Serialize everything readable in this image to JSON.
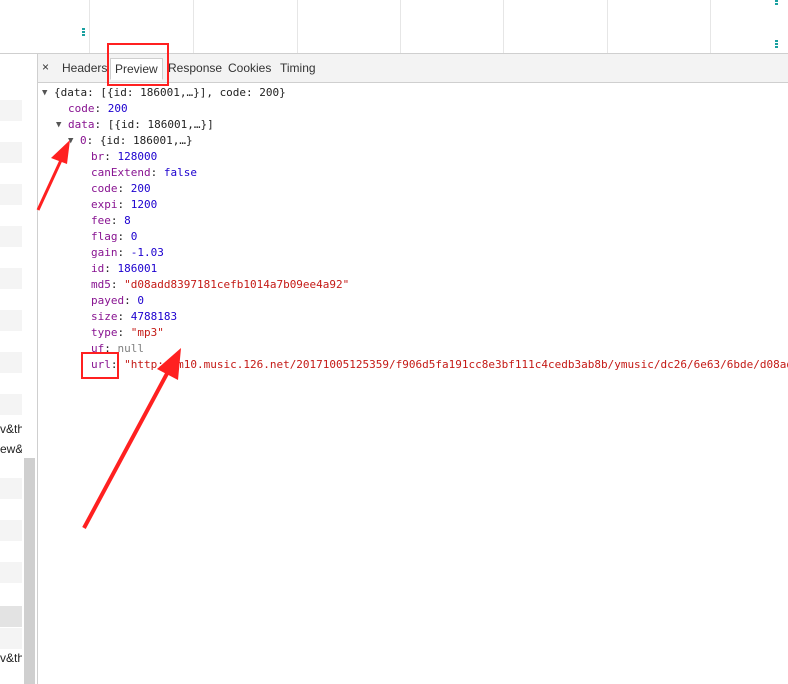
{
  "tabs": {
    "close": "×",
    "headers": "Headers",
    "preview": "Preview",
    "response": "Response",
    "cookies": "Cookies",
    "timing": "Timing"
  },
  "left_list": {
    "row1": "v&th",
    "row2": "ew&",
    "row3": "v&th"
  },
  "json": {
    "root": "{data: [{id: 186001,…}], code: 200}",
    "code_key": "code",
    "code_val": "200",
    "data_key": "data",
    "data_val": "[{id: 186001,…}]",
    "item0_key": "0",
    "item0_val": "{id: 186001,…}",
    "fields": [
      {
        "key": "br",
        "value": "128000",
        "kind": "num"
      },
      {
        "key": "canExtend",
        "value": "false",
        "kind": "num"
      },
      {
        "key": "code",
        "value": "200",
        "kind": "num"
      },
      {
        "key": "expi",
        "value": "1200",
        "kind": "num"
      },
      {
        "key": "fee",
        "value": "8",
        "kind": "num"
      },
      {
        "key": "flag",
        "value": "0",
        "kind": "num"
      },
      {
        "key": "gain",
        "value": "-1.03",
        "kind": "num"
      },
      {
        "key": "id",
        "value": "186001",
        "kind": "num"
      },
      {
        "key": "md5",
        "value": "\"d08add8397181cefb1014a7b09ee4a92\"",
        "kind": "str"
      },
      {
        "key": "payed",
        "value": "0",
        "kind": "num"
      },
      {
        "key": "size",
        "value": "4788183",
        "kind": "num"
      },
      {
        "key": "type",
        "value": "\"mp3\"",
        "kind": "str"
      },
      {
        "key": "uf",
        "value": "null",
        "kind": "nul"
      },
      {
        "key": "url",
        "value": "\"http://m10.music.126.net/20171005125359/f906d5fa191cc8e3bf111c4cedb3ab8b/ymusic/dc26/6e63/6bde/d08ad",
        "kind": "str"
      }
    ]
  },
  "colors": {
    "annotation": "#ff2020",
    "key": "#881391",
    "number": "#1c00cf",
    "string": "#c41a16"
  }
}
